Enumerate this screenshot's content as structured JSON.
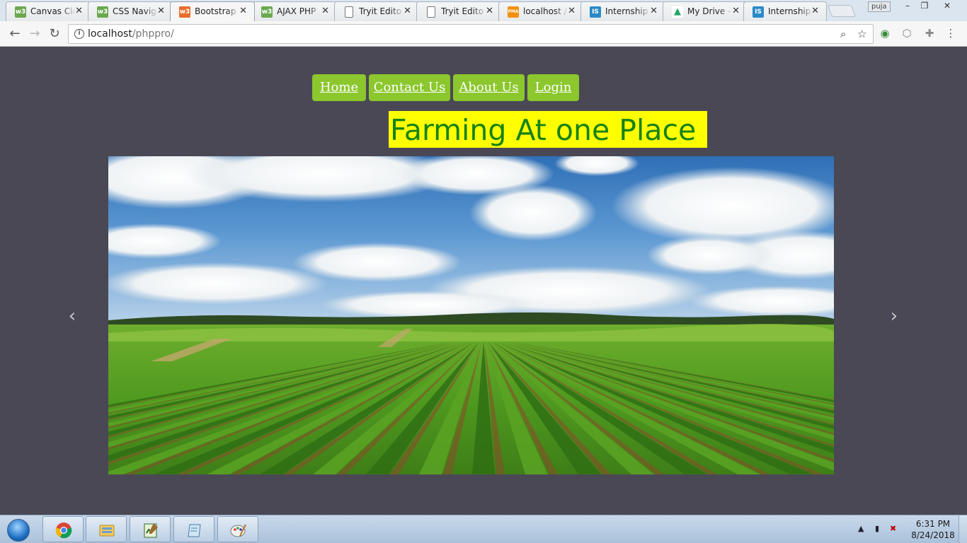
{
  "browser": {
    "tabs": [
      {
        "title": "Canvas Clo",
        "favicon": "w3schools-icon",
        "fav_text": "w3",
        "fav_color": "#6aa84f"
      },
      {
        "title": "CSS Naviga",
        "favicon": "w3schools-icon",
        "fav_text": "w3",
        "fav_color": "#6aa84f"
      },
      {
        "title": "Bootstrap",
        "favicon": "w3schools-icon",
        "fav_text": "w3",
        "fav_color": "#e86e2b"
      },
      {
        "title": "AJAX PHP",
        "favicon": "w3schools-icon",
        "fav_text": "w3",
        "fav_color": "#6aa84f"
      },
      {
        "title": "Tryit Edito",
        "favicon": "document-icon",
        "fav_text": "",
        "fav_color": "#ffffff"
      },
      {
        "title": "Tryit Edito",
        "favicon": "document-icon",
        "fav_text": "",
        "fav_color": "#ffffff"
      },
      {
        "title": "localhost /",
        "favicon": "phpmyadmin-icon",
        "fav_text": "PMA",
        "fav_color": "#f29111"
      },
      {
        "title": "Internship",
        "favicon": "internshala-icon",
        "fav_text": "IS",
        "fav_color": "#2a8ac7"
      },
      {
        "title": "My Drive -",
        "favicon": "google-drive-icon",
        "fav_text": "▲",
        "fav_color": "#ffffff"
      },
      {
        "title": "Internship",
        "favicon": "internshala-icon",
        "fav_text": "IS",
        "fav_color": "#2a8ac7"
      }
    ],
    "profile_name": "puja",
    "url_host": "localhost",
    "url_path": "/phppro/"
  },
  "page": {
    "nav": [
      {
        "label": "Home"
      },
      {
        "label": "Contact Us"
      },
      {
        "label": "About Us"
      },
      {
        "label": "Login"
      }
    ],
    "title": "Farming At one Place",
    "nav_color": "#8bc72d",
    "title_bg": "#ffff00",
    "title_color": "#178216",
    "background": "#4a4854",
    "carousel_prev": "‹",
    "carousel_next": "›"
  },
  "taskbar": {
    "time": "6:31 PM",
    "date": "8/24/2018"
  }
}
